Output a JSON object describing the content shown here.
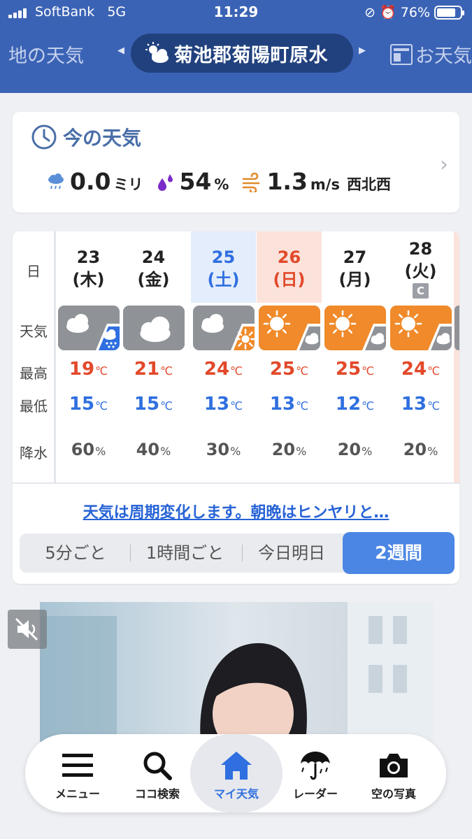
{
  "status": {
    "carrier": "SoftBank",
    "network": "5G",
    "time": "11:29",
    "battery": "76%"
  },
  "header": {
    "prev_tab": "地の天気",
    "location": "菊池郡菊陽町原水",
    "next_tab": "お天気"
  },
  "now": {
    "title": "今の天気",
    "precip_value": "0.0",
    "precip_unit": "ミリ",
    "humidity_value": "54",
    "humidity_unit": "%",
    "wind_value": "1.3",
    "wind_unit": "m/s",
    "wind_dir": "西北西"
  },
  "forecast": {
    "row_labels": {
      "day": "日",
      "weather": "天気",
      "high": "最高",
      "low": "最低",
      "rain": "降水"
    },
    "temp_unit": "℃",
    "rain_unit": "%",
    "days": [
      {
        "date": "23",
        "dow": "(木)",
        "weather": "cloudy / rain",
        "high": "19",
        "low": "15",
        "rain": "60"
      },
      {
        "date": "24",
        "dow": "(金)",
        "weather": "cloudy",
        "high": "21",
        "low": "15",
        "rain": "40"
      },
      {
        "date": "25",
        "dow": "(土)",
        "weather": "cloudy / sunny",
        "high": "24",
        "low": "13",
        "rain": "30"
      },
      {
        "date": "26",
        "dow": "(日)",
        "weather": "sunny / cloudy",
        "high": "25",
        "low": "13",
        "rain": "20"
      },
      {
        "date": "27",
        "dow": "(月)",
        "weather": "sunny / cloudy",
        "high": "25",
        "low": "12",
        "rain": "20"
      },
      {
        "date": "28",
        "dow": "(火)",
        "badge": "C",
        "weather": "sunny / cloudy",
        "high": "24",
        "low": "13",
        "rain": "20"
      }
    ],
    "comment": "天気は周期変化します。朝晩はヒンヤリと…",
    "tabs": [
      "5分ごと",
      "1時間ごと",
      "今日明日",
      "2週間"
    ],
    "active_tab": "2週間"
  },
  "bottom_nav": [
    {
      "label": "メニュー",
      "icon": "menu-icon"
    },
    {
      "label": "ココ検索",
      "icon": "search-icon"
    },
    {
      "label": "マイ天気",
      "icon": "home-icon"
    },
    {
      "label": "レーダー",
      "icon": "umbrella-icon"
    },
    {
      "label": "空の写真",
      "icon": "camera-icon"
    }
  ],
  "colors": {
    "header": "#3b63b5",
    "pill": "#21417e",
    "accent": "#4c86e4",
    "high": "#e2492a",
    "low": "#2f6fe0",
    "sunny_tile": "#f08a2a",
    "cloudy_tile": "#8f9398",
    "rain_tile": "#2f6fe0"
  }
}
